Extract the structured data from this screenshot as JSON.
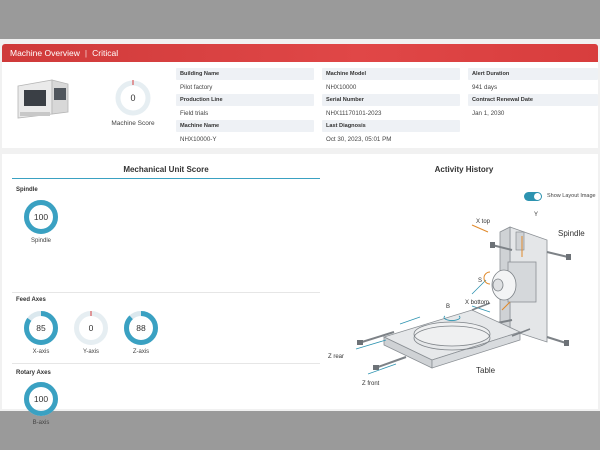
{
  "header": {
    "title": "Machine Overview",
    "status": "Critical"
  },
  "machine": {
    "score": "0",
    "score_label": "Machine Score"
  },
  "info": [
    {
      "label": "Building Name",
      "value": "Pilot factory"
    },
    {
      "label": "Production Line",
      "value": "Field trials"
    },
    {
      "label": "Machine Name",
      "value": "NHX10000-Y"
    },
    {
      "label": "Machine Model",
      "value": "NHX10000"
    },
    {
      "label": "Serial Number",
      "value": "NHX11170101-2023"
    },
    {
      "label": "Last Diagnosis",
      "value": "Oct 30, 2023, 05:01 PM"
    },
    {
      "label": "Alert Duration",
      "value": "941 days"
    },
    {
      "label": "Contract Renewal Date",
      "value": "Jan 1, 2030"
    }
  ],
  "mech": {
    "title": "Mechanical Unit Score",
    "spindle_group": "Spindle",
    "feed_group": "Feed Axes",
    "rotary_group": "Rotary Axes",
    "gauges": {
      "spindle": {
        "value": "100",
        "label": "Spindle",
        "level": 1.0
      },
      "x": {
        "value": "85",
        "label": "X-axis",
        "level": 0.85
      },
      "y": {
        "value": "0",
        "label": "Y-axis",
        "level": 0.0
      },
      "z": {
        "value": "88",
        "label": "Z-axis",
        "level": 0.88
      },
      "b": {
        "value": "100",
        "label": "B-axis",
        "level": 1.0
      }
    }
  },
  "activity": {
    "title": "Activity History",
    "toggle_label": "Show Layout Image",
    "diagram": {
      "x_top": "X top",
      "y": "Y",
      "spindle": "Spindle",
      "s": "S",
      "x_bottom": "X bottom",
      "b": "B",
      "z_rear": "Z rear",
      "z_front": "Z front",
      "table": "Table"
    }
  },
  "colors": {
    "accent": "#3aa1c2",
    "critical": "#d83d3d",
    "ring_track": "#dbe8ee"
  }
}
